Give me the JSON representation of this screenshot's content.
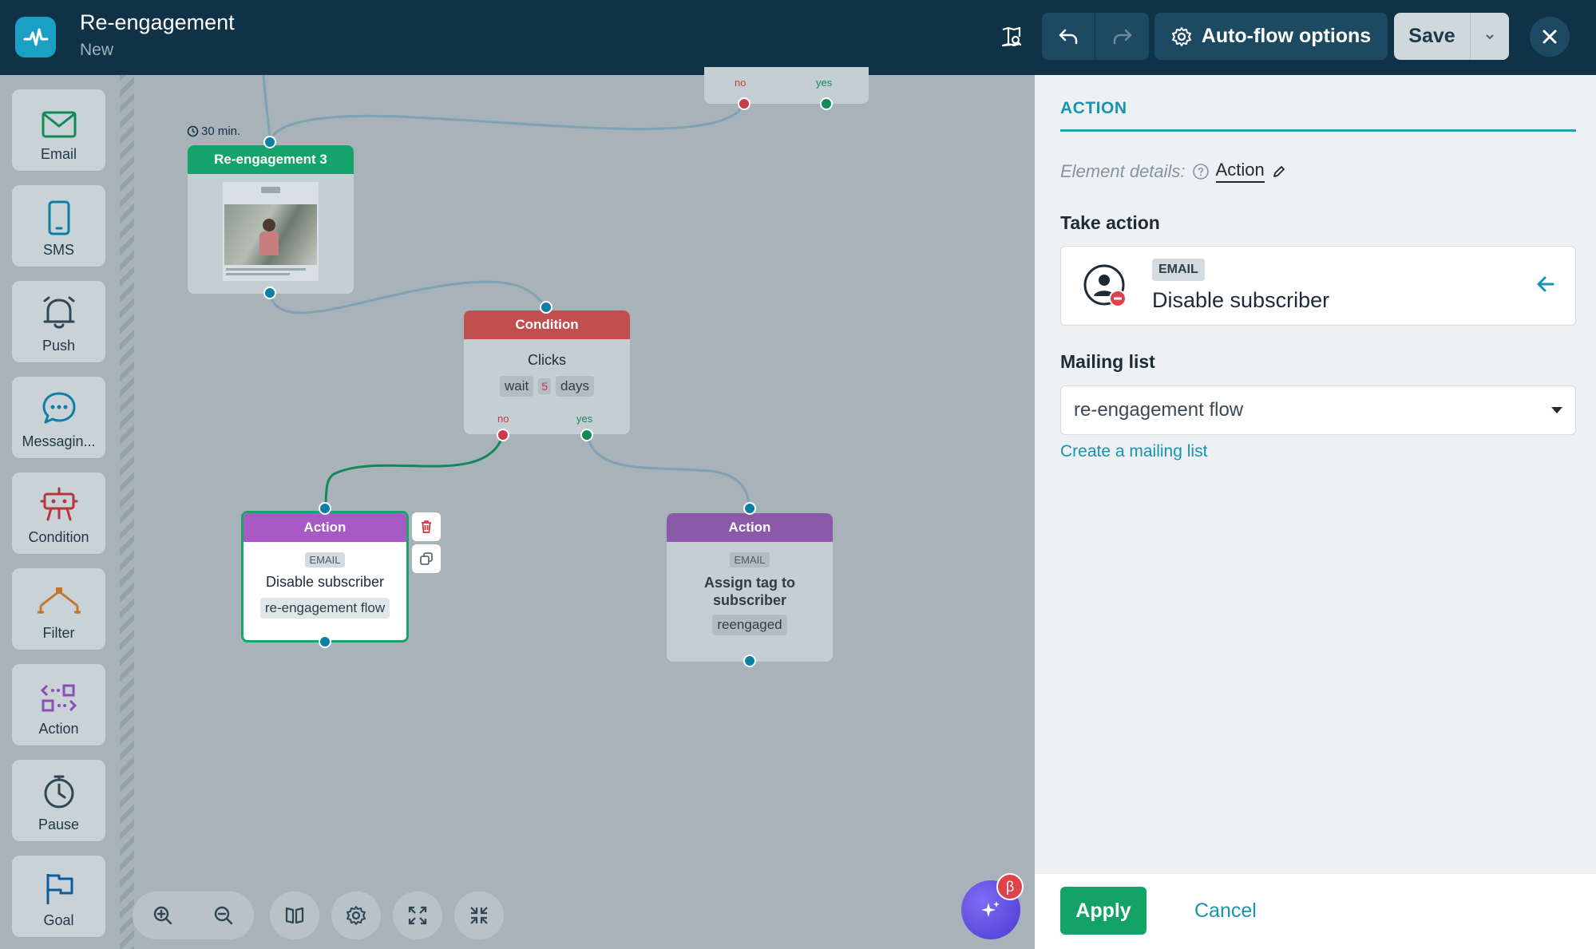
{
  "header": {
    "title": "Re-engagement",
    "subtitle": "New",
    "auto_flow_label": "Auto-flow options",
    "save_label": "Save"
  },
  "palette": {
    "items": [
      {
        "label": "Email",
        "icon": "envelope-icon"
      },
      {
        "label": "SMS",
        "icon": "phone-icon"
      },
      {
        "label": "Push",
        "icon": "bell-icon"
      },
      {
        "label": "Messagin...",
        "icon": "chat-bubble-icon"
      },
      {
        "label": "Condition",
        "icon": "condition-icon"
      },
      {
        "label": "Filter",
        "icon": "filter-icon"
      },
      {
        "label": "Action",
        "icon": "action-icon"
      },
      {
        "label": "Pause",
        "icon": "stopwatch-icon"
      },
      {
        "label": "Goal",
        "icon": "flag-icon"
      }
    ]
  },
  "canvas": {
    "top_condition": {
      "no_label": "no",
      "yes_label": "yes"
    },
    "email_node": {
      "delay": "30 min.",
      "title": "Re-engagement 3"
    },
    "condition_node": {
      "title": "Condition",
      "metric": "Clicks",
      "wait_label": "wait",
      "wait_value": "5",
      "wait_unit": "days",
      "no_label": "no",
      "yes_label": "yes"
    },
    "action_left": {
      "title": "Action",
      "badge": "EMAIL",
      "name": "Disable subscriber",
      "value": "re-engagement flow"
    },
    "action_right": {
      "title": "Action",
      "badge": "EMAIL",
      "name": "Assign tag to subscriber",
      "value": "reengaged"
    },
    "beta_badge": "β"
  },
  "panel": {
    "heading": "ACTION",
    "element_details_label": "Element details:",
    "element_details_value": "Action",
    "take_action_title": "Take action",
    "action_badge": "EMAIL",
    "action_name": "Disable subscriber",
    "mailing_list_title": "Mailing list",
    "mailing_list_value": "re-engagement flow",
    "create_link": "Create a mailing list",
    "apply_label": "Apply",
    "cancel_label": "Cancel"
  },
  "colors": {
    "topbar": "#0f3247",
    "accent": "#1894b0",
    "email_green": "#14a36a",
    "condition_red": "#c14f4f",
    "action_purple_active": "#a75ac4",
    "action_purple": "#8a5aa8",
    "apply_green": "#14a366"
  }
}
